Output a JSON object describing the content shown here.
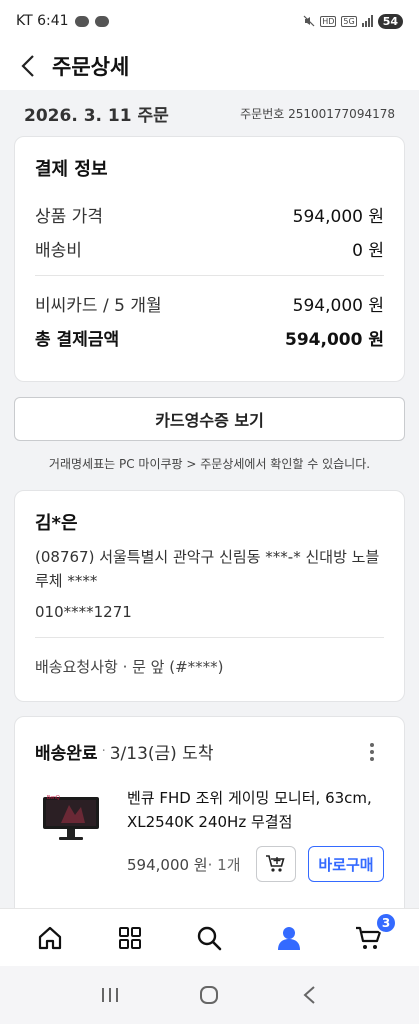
{
  "status_bar": {
    "carrier_time": "KT 6:41",
    "network_hd": "HD",
    "network_5g": "5G",
    "battery": "54"
  },
  "header": {
    "title": "주문상세"
  },
  "order": {
    "date": "2026. 3. 11 주문",
    "number": "주문번호 25100177094178"
  },
  "payment": {
    "title": "결제 정보",
    "product_price_label": "상품 가격",
    "product_price_value": "594,000 원",
    "shipping_label": "배송비",
    "shipping_value": "0 원",
    "card_label": "비씨카드 / 5 개월",
    "card_value": "594,000 원",
    "total_label": "총 결제금액",
    "total_value": "594,000 원"
  },
  "receipt_button": "카드영수증 보기",
  "notice": "거래명세표는 PC 마이쿠팡 > 주문상세에서 확인할 수 있습니다.",
  "address": {
    "recipient": "김*은",
    "line": "(08767) 서울특별시 관악구 신림동 ***-* 신대방 노블루체 ****",
    "phone": "010****1271",
    "request": "배송요청사항 · 문 앞 (#****)"
  },
  "delivery": {
    "status": "배송완료",
    "separator": "·",
    "date": "3/13(금) 도착",
    "product_name": "벤큐 FHD 조위 게이밍 모니터, 63cm, XL2540K 240Hz 무결점",
    "price": "594,000 원",
    "qty": " · 1개",
    "buy_now": "바로구매",
    "thumb_brand": "BenQ"
  },
  "bottom_nav": {
    "cart_count": "3",
    "accent": "#346aff"
  }
}
